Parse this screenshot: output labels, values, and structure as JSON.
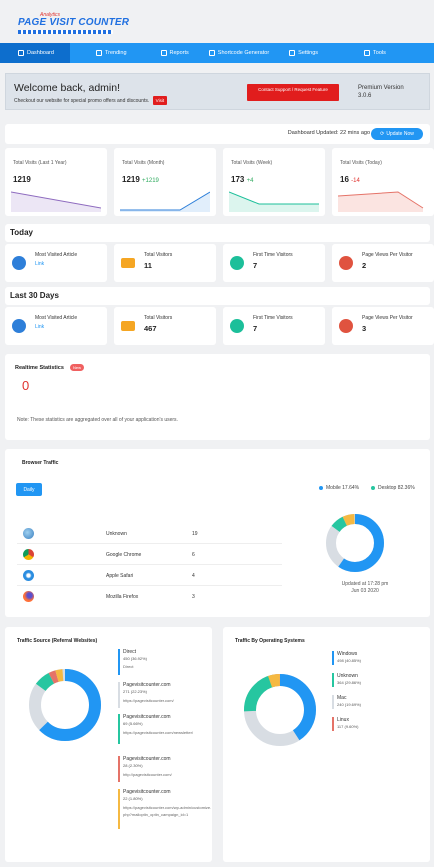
{
  "logo": {
    "small": "Analytics",
    "big": "PAGE VISIT COUNTER"
  },
  "nav": [
    {
      "label": "Dashboard",
      "icon": "monitor-icon"
    },
    {
      "label": "Trending",
      "icon": "trend-icon"
    },
    {
      "label": "Reports",
      "icon": "reports-icon"
    },
    {
      "label": "Shortcode Generator",
      "icon": "palette-icon"
    },
    {
      "label": "Settings",
      "icon": "settings-icon"
    },
    {
      "label": "Tools",
      "icon": "tools-icon"
    }
  ],
  "welcome": {
    "title": "Welcome back, admin!",
    "subtitle": "Checkout our website for special promo offers and discounts.",
    "visit_label": "Visit",
    "support_label": "Contact Support / Request Feature",
    "premium_line1": "Premium Version",
    "premium_line2": "3.0.6"
  },
  "dashboard": {
    "updated": "Dashboard Updated: 22 mins ago",
    "update_button": "Update Now"
  },
  "stats": [
    {
      "label": "Total Visits (Last 1 Year)",
      "value": "1219",
      "delta": "",
      "color": "#8e6bbf"
    },
    {
      "label": "Total Visits (Month)",
      "value": "1219",
      "delta": "+1219",
      "color": "#2e7fd9"
    },
    {
      "label": "Total Visits (Week)",
      "value": "173",
      "delta": "+4",
      "color": "#1cbf9a"
    },
    {
      "label": "Total Visits (Today)",
      "value": "16",
      "delta": "-14",
      "color": "#e57368"
    }
  ],
  "today": {
    "title": "Today",
    "items": [
      {
        "title": "Most Visited Article",
        "value": "",
        "link": "Link",
        "icon": "clock-icon"
      },
      {
        "title": "Total Visitors",
        "value": "11",
        "link": "",
        "icon": "laptop-icon"
      },
      {
        "title": "First Time Visitors",
        "value": "7",
        "link": "",
        "icon": "user-icon"
      },
      {
        "title": "Page Views Per Visitor",
        "value": "2",
        "link": "",
        "icon": "globe-icon"
      }
    ]
  },
  "last30": {
    "title": "Last 30 Days",
    "items": [
      {
        "title": "Most Visited Article",
        "value": "",
        "link": "Link",
        "icon": "clock-icon"
      },
      {
        "title": "Total Visitors",
        "value": "467",
        "link": "",
        "icon": "laptop-icon"
      },
      {
        "title": "First Time Visitors",
        "value": "7",
        "link": "",
        "icon": "user-icon"
      },
      {
        "title": "Page Views Per Visitor",
        "value": "3",
        "link": "",
        "icon": "globe-icon"
      }
    ]
  },
  "realtime": {
    "title": "Realtime Statistics",
    "badge": "New",
    "value": "0",
    "note": "Note: These statistics are aggregated over all of your application's users."
  },
  "browser": {
    "title": "Browser Traffic",
    "daily": "Daily",
    "legend": [
      {
        "label": "Mobile 17.64%",
        "color": "#2196f3"
      },
      {
        "label": "Desktop 82.36%",
        "color": "#26c6a0"
      }
    ],
    "rows": [
      {
        "name": "Unknown",
        "count": "19",
        "icon": "unknown-browser-icon"
      },
      {
        "name": "Google Chrome",
        "count": "6",
        "icon": "chrome-icon"
      },
      {
        "name": "Apple Safari",
        "count": "4",
        "icon": "safari-icon"
      },
      {
        "name": "Mozilla Firefox",
        "count": "3",
        "icon": "firefox-icon"
      }
    ],
    "updated_line1": "Updated at 17:28 pm",
    "updated_line2": "Jun 03 2020"
  },
  "referral": {
    "title": "Traffic Source (Referral Websites)",
    "items": [
      {
        "name": "Direct",
        "count": "450 (36.92%)",
        "url": "Direct",
        "color": "#2196f3"
      },
      {
        "name": "Pagevisitcounter.com",
        "count": "271 (22.23%)",
        "url": "https://pagevisitcounter.com/",
        "color": "#d8dde3"
      },
      {
        "name": "Pagevisitcounter.com",
        "count": "69 (5.66%)",
        "url": "https://pagevisitcounter.com/newsletter/",
        "color": "#26c6a0"
      },
      {
        "name": "Pagevisitcounter.com",
        "count": "28 (2.30%)",
        "url": "http://pagevisitcounter.com/",
        "color": "#e57368"
      },
      {
        "name": "Pagevisitcounter.com",
        "count": "22 (1.80%)",
        "url": "https://pagevisitcounter.com/wp-admin/customize.php?mailoptin_optin_campaign_id=1",
        "color": "#f5b942"
      }
    ]
  },
  "os": {
    "title": "Traffic By Operating Systems",
    "items": [
      {
        "name": "Windows",
        "count": "498 (40.85%)",
        "color": "#2196f3"
      },
      {
        "name": "Unknown",
        "count": "364 (29.86%)",
        "color": "#26c6a0"
      },
      {
        "name": "Mac",
        "count": "240 (19.69%)",
        "color": "#d8dde3"
      },
      {
        "name": "Linux",
        "count": "117 (9.60%)",
        "color": "#e57368"
      }
    ]
  }
}
